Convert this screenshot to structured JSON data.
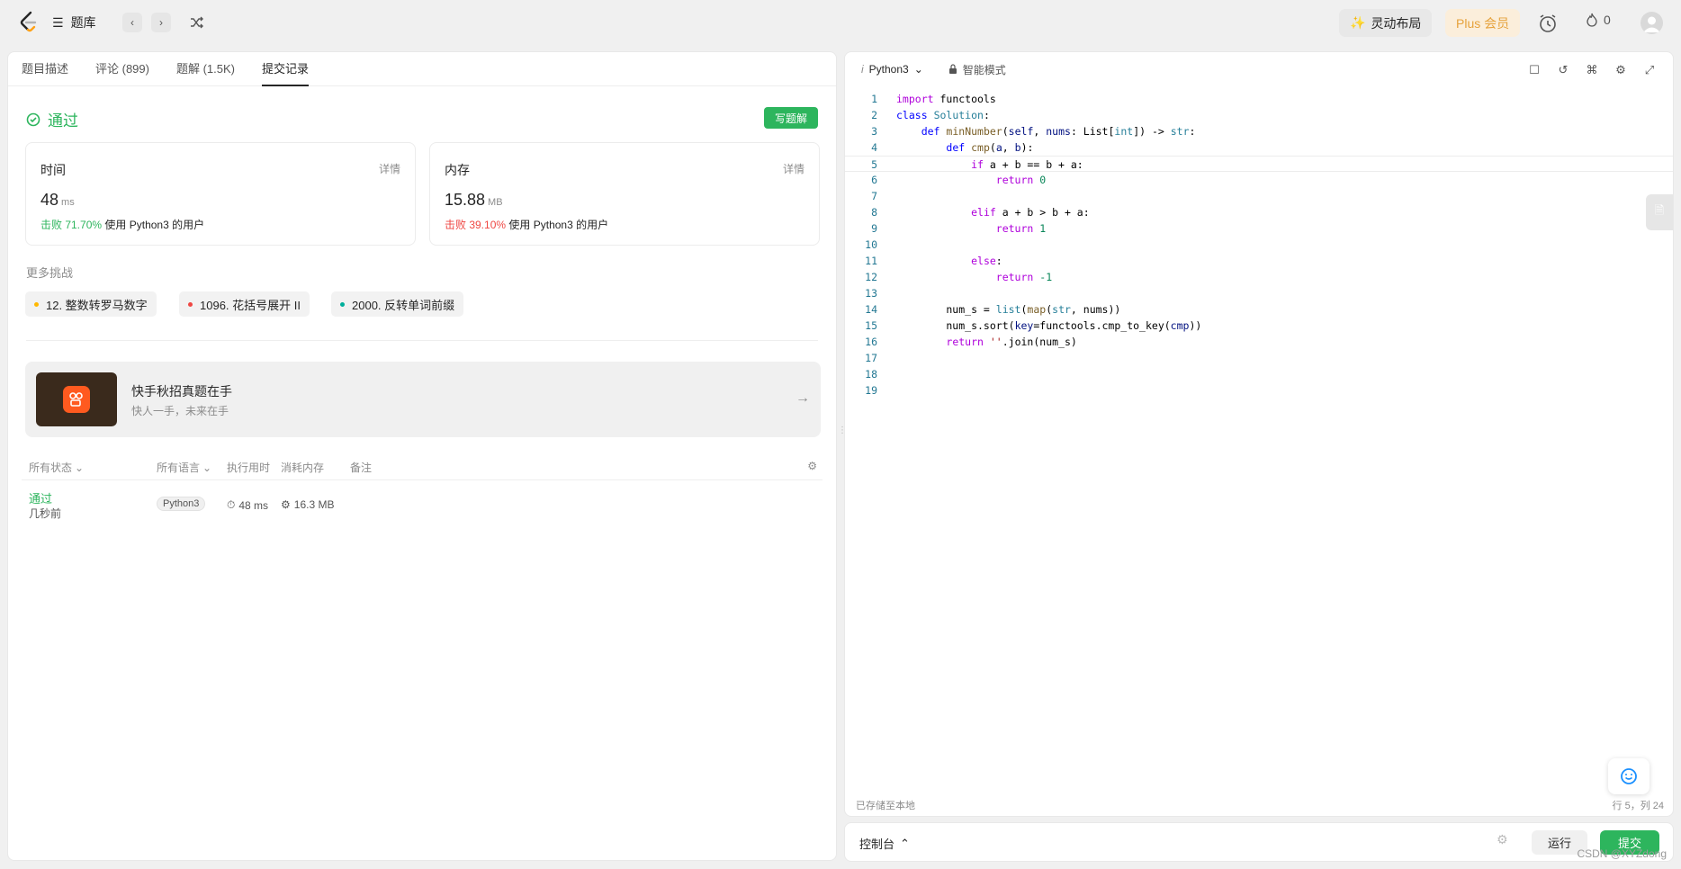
{
  "topbar": {
    "library": "题库",
    "layout_btn": "灵动布局",
    "plus_btn": "Plus 会员",
    "streak": "0"
  },
  "left": {
    "tabs": [
      "题目描述",
      "评论 (899)",
      "题解 (1.5K)",
      "提交记录"
    ],
    "status": "通过",
    "write_btn": "写题解",
    "time_card": {
      "title": "时间",
      "detail": "详情",
      "value": "48",
      "unit": "ms",
      "beat": "击败 71.70%",
      "beat_suffix": "使用 Python3 的用户"
    },
    "mem_card": {
      "title": "内存",
      "detail": "详情",
      "value": "15.88",
      "unit": "MB",
      "beat": "击败 39.10%",
      "beat_suffix": "使用 Python3 的用户"
    },
    "more_title": "更多挑战",
    "chips": [
      {
        "label": "12. 整数转罗马数字",
        "color": "#ffb800"
      },
      {
        "label": "1096. 花括号展开 II",
        "color": "#ef4743"
      },
      {
        "label": "2000. 反转单词前缀",
        "color": "#00af9b"
      }
    ],
    "promo": {
      "title": "快手秋招真题在手",
      "sub": "快人一手，未来在手"
    },
    "table": {
      "headers": {
        "status": "所有状态",
        "lang": "所有语言",
        "runtime": "执行用时",
        "memory": "消耗内存",
        "note": "备注"
      },
      "row": {
        "status": "通过",
        "time": "几秒前",
        "lang": "Python3",
        "runtime": "48 ms",
        "memory": "16.3 MB"
      }
    }
  },
  "editor": {
    "lang": "Python3",
    "mode": "智能模式",
    "saved": "已存储至本地",
    "cursor": "行 5，列 24"
  },
  "console": {
    "label": "控制台",
    "run": "运行",
    "submit": "提交",
    "watermark": "CSDN @XYZdong"
  }
}
